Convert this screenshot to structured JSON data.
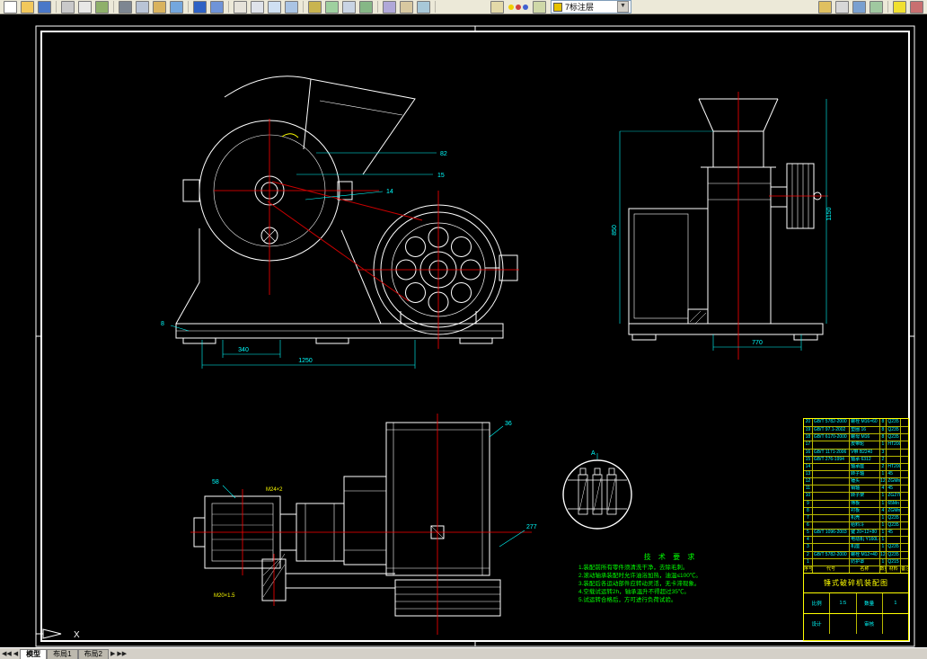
{
  "toolbar": {
    "layer_combo": "7标注层",
    "icons_left": [
      {
        "name": "qnew-icon",
        "color": "#ffffff"
      },
      {
        "name": "open-icon",
        "color": "#f2c85c"
      },
      {
        "name": "save-icon",
        "color": "#4a78c8"
      },
      {
        "type": "sep"
      },
      {
        "name": "plot-icon",
        "color": "#c9c9c9"
      },
      {
        "name": "plot-preview-icon",
        "color": "#e8e8e6"
      },
      {
        "name": "publish-icon",
        "color": "#8fb06a"
      },
      {
        "type": "sep"
      },
      {
        "name": "cut-icon",
        "color": "#7d8691"
      },
      {
        "name": "copy-icon",
        "color": "#b9c4d6"
      },
      {
        "name": "paste-icon",
        "color": "#d9b35e"
      },
      {
        "name": "match-properties-icon",
        "color": "#74a7dd"
      },
      {
        "type": "sep"
      },
      {
        "name": "undo-icon",
        "color": "#2f62c4"
      },
      {
        "name": "redo-icon",
        "color": "#6f94d8"
      },
      {
        "type": "sep"
      },
      {
        "name": "pan-icon",
        "color": "#e6e3da"
      },
      {
        "name": "zoom-realtime-icon",
        "color": "#dfe3ea"
      },
      {
        "name": "zoom-window-icon",
        "color": "#cfe0f2"
      },
      {
        "name": "zoom-previous-icon",
        "color": "#aac4e4"
      },
      {
        "type": "sep"
      },
      {
        "name": "distance-icon",
        "color": "#c9b44f"
      },
      {
        "name": "redraw-icon",
        "color": "#9fd09f"
      },
      {
        "name": "named-views-icon",
        "color": "#c9d4e4"
      },
      {
        "name": "3d-orbit-icon",
        "color": "#86b786"
      },
      {
        "type": "sep"
      },
      {
        "name": "properties-icon",
        "color": "#b0a8d8"
      },
      {
        "name": "designcenter-icon",
        "color": "#d8c8a0"
      },
      {
        "name": "tool-palettes-icon",
        "color": "#a8c8d8"
      },
      {
        "type": "sep"
      },
      {
        "type": "space",
        "w": 56
      },
      {
        "name": "layer-properties-icon",
        "color": "#e3d9a8"
      },
      {
        "type": "dots"
      },
      {
        "name": "layer-previous-icon",
        "color": "#cfd8a8"
      },
      {
        "type": "combo"
      }
    ],
    "icons_right": [
      {
        "name": "standards-icon",
        "color": "#e0c060"
      },
      {
        "name": "dim-style-icon",
        "color": "#d8d8d8"
      },
      {
        "name": "text-style-icon",
        "color": "#7aa0d0"
      },
      {
        "name": "table-style-icon",
        "color": "#a0c8a0"
      },
      {
        "type": "sep"
      },
      {
        "name": "pencil-icon",
        "color": "#f0e030"
      },
      {
        "name": "erase-icon",
        "color": "#c87070"
      }
    ]
  },
  "tabs": {
    "scroll_left": "◀◀ ◀",
    "scroll_right": "▶ ▶▶",
    "items": [
      "模型",
      "布局1",
      "布局2"
    ],
    "active": "模型"
  },
  "ucs": {
    "x_label": "X"
  },
  "drawing": {
    "colors": {
      "line": "#ffffff",
      "center": "#ff0000",
      "dim": "#00ffff",
      "note": "#00ff00",
      "table": "#ffff00"
    },
    "dims": {
      "front_a": "82",
      "front_b": "15",
      "front_c": "14",
      "front_left": "8",
      "front_base1": "340",
      "front_base2": "1250",
      "side_left_h": "850",
      "side_right_h": "1150",
      "side_base_w": "770",
      "plan_36": "36",
      "plan_58": "58",
      "plan_277": "277",
      "thread1": "M24×2",
      "thread2": "M20×1.5",
      "detail_label": "A"
    },
    "notes": {
      "title": "技 术 要 求",
      "lines": [
        "1.装配前所有零件须清洗干净，去除毛刺。",
        "2.滚动轴承装配时允许油浴加热，油温≤100℃。",
        "3.装配后各运动部件应转动灵活，无卡滞现象。",
        "4.空载试运转2h，轴承温升不得超过35℃。",
        "5.试运转合格后，方可进行负荷试验。"
      ]
    },
    "bom": {
      "header": {
        "no": "序号",
        "code": "代号",
        "name": "名称",
        "qty": "数量",
        "mat": "材料",
        "note": "备注"
      },
      "items": [
        {
          "no": "20",
          "code": "GB/T 5782-2000",
          "name": "螺栓 M16×60",
          "qty": "8",
          "mat": "Q235",
          "note": ""
        },
        {
          "no": "19",
          "code": "GB/T 97.1-2002",
          "name": "垫圈 16",
          "qty": "8",
          "mat": "Q235",
          "note": ""
        },
        {
          "no": "18",
          "code": "GB/T 6170-2000",
          "name": "螺母 M16",
          "qty": "8",
          "mat": "Q235",
          "note": ""
        },
        {
          "no": "17",
          "code": "",
          "name": "皮带轮",
          "qty": "1",
          "mat": "HT200",
          "note": ""
        },
        {
          "no": "16",
          "code": "GB/T 1171-2006",
          "name": "V带 B2240",
          "qty": "3",
          "mat": "",
          "note": ""
        },
        {
          "no": "15",
          "code": "GB/T 276-1994",
          "name": "轴承 6312",
          "qty": "2",
          "mat": "",
          "note": ""
        },
        {
          "no": "14",
          "code": "",
          "name": "轴承座",
          "qty": "2",
          "mat": "HT200",
          "note": ""
        },
        {
          "no": "13",
          "code": "",
          "name": "转子轴",
          "qty": "1",
          "mat": "45",
          "note": ""
        },
        {
          "no": "12",
          "code": "",
          "name": "锤头",
          "qty": "12",
          "mat": "ZGMn13",
          "note": ""
        },
        {
          "no": "11",
          "code": "",
          "name": "销轴",
          "qty": "4",
          "mat": "45",
          "note": ""
        },
        {
          "no": "10",
          "code": "",
          "name": "转子架",
          "qty": "1",
          "mat": "ZG270",
          "note": ""
        },
        {
          "no": "9",
          "code": "",
          "name": "筛板",
          "qty": "1",
          "mat": "65Mn",
          "note": ""
        },
        {
          "no": "8",
          "code": "",
          "name": "衬板",
          "qty": "4",
          "mat": "ZGMn13",
          "note": ""
        },
        {
          "no": "7",
          "code": "",
          "name": "机壳",
          "qty": "1",
          "mat": "Q235",
          "note": ""
        },
        {
          "no": "6",
          "code": "",
          "name": "给料斗",
          "qty": "1",
          "mat": "Q235",
          "note": ""
        },
        {
          "no": "5",
          "code": "GB/T 1096-2003",
          "name": "键 20×12×80",
          "qty": "1",
          "mat": "45",
          "note": ""
        },
        {
          "no": "4",
          "code": "",
          "name": "电动机 Y160L-4",
          "qty": "1",
          "mat": "",
          "note": ""
        },
        {
          "no": "3",
          "code": "",
          "name": "机座",
          "qty": "1",
          "mat": "Q235",
          "note": ""
        },
        {
          "no": "2",
          "code": "GB/T 5782-2000",
          "name": "螺栓 M12×40",
          "qty": "12",
          "mat": "Q235",
          "note": ""
        },
        {
          "no": "1",
          "code": "",
          "name": "防护罩",
          "qty": "1",
          "mat": "Q215",
          "note": ""
        }
      ],
      "title_block": {
        "name_row": [
          "锤式破碎机装配图"
        ],
        "row2": [
          "比例",
          "1:5",
          "数量",
          "1"
        ],
        "row3": [
          "设计",
          "",
          "审核",
          ""
        ]
      }
    }
  }
}
